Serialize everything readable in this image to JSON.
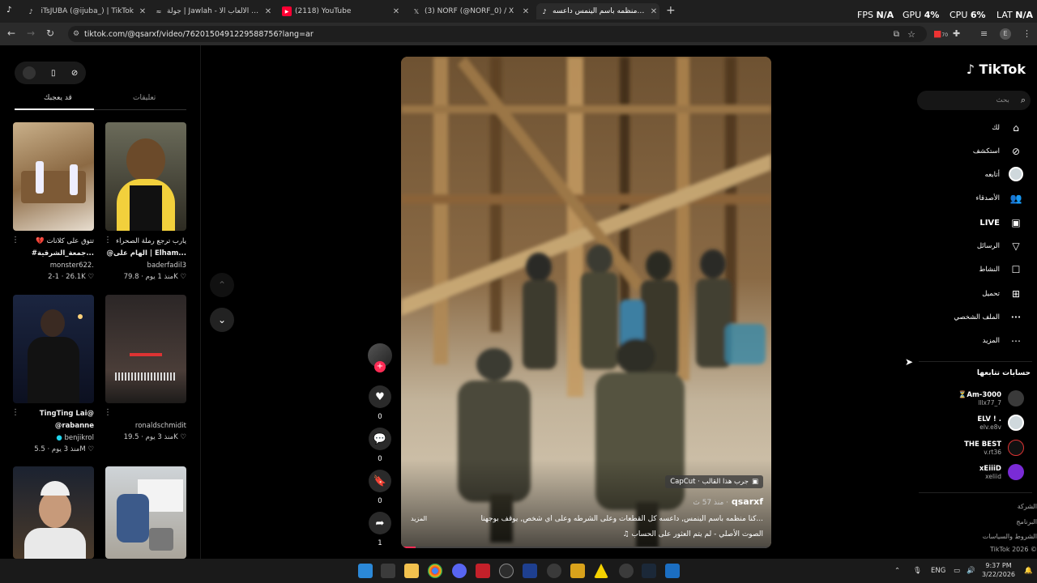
{
  "browser": {
    "tabs": [
      {
        "title": "iTsJUBA (@ijuba_) | TikTok",
        "favicon": "tiktok-icon"
      },
      {
        "title": "جولة | Jawlah - منصة الألعاب الا...",
        "favicon": "jawlah-icon"
      },
      {
        "title": "(2118) YouTube",
        "favicon": "youtube-icon"
      },
      {
        "title": "(3) NORF (@NORF_0) / X",
        "favicon": "x-icon"
      },
      {
        "title": "كنا منظمه باسم الينمس داعسه",
        "favicon": "tiktok-icon",
        "active": true
      }
    ],
    "new_tab": "+",
    "url": "tiktok.com/@qsarxf/video/7620150491229588756?lang=ar",
    "perf": {
      "fps_label": "FPS",
      "fps_value": "N/A",
      "gpu_label": "GPU",
      "gpu_value": "4%",
      "cpu_label": "CPU",
      "cpu_value": "6%",
      "lat_label": "LAT",
      "lat_value": "N/A"
    },
    "ext_badge": "70"
  },
  "left_panel": {
    "tabs": [
      "قد يعجبك",
      "تعليقات"
    ],
    "active_tab": "قد يعجبك",
    "videos": [
      {
        "caption": "💔 تتوق على كلانات",
        "caption2": "#جمعة_الشرقية...",
        "user": "monster622.",
        "likes": "26.1K",
        "date": "2-1"
      },
      {
        "caption": "يارب ترجع رملة الصحراء",
        "caption2": "@الهام على | Elham...",
        "user": "baderfadil3",
        "likes": "79.8K",
        "date": "منذ 1 يوم"
      },
      {
        "caption": "TingTing Lai@",
        "caption2": "@rabanne",
        "user": "benjikrol",
        "likes": "5.5M",
        "date": "منذ 3 يوم"
      },
      {
        "caption": "",
        "caption2": "",
        "user": "ronaldschmidit",
        "likes": "19.5K",
        "date": "منذ 3 يوم"
      },
      {
        "caption": "",
        "caption2": "",
        "user": "",
        "likes": "",
        "date": ""
      },
      {
        "caption": "",
        "caption2": "",
        "user": "",
        "likes": "",
        "date": ""
      }
    ]
  },
  "video": {
    "capcut": "CapCut · جرب هذا القالب",
    "username": "qsarxf",
    "time": "منذ 57 ث ·",
    "description": "كنا منظمه باسم الينمس, داعسه كل القطعات وعلى الشرطه وعلى اي شخص, يوقف بوجهنا...",
    "more": "المزيد",
    "sound": "♫ الصوت الأصلي - لم يتم العثور على الحساب",
    "progress": 0.04,
    "actions": {
      "likes": "0",
      "comments": "0",
      "saves": "0",
      "shares": "1"
    }
  },
  "sidebar": {
    "logo": "TikTok",
    "search_placeholder": "بحث",
    "nav": [
      {
        "label": "لك",
        "icon": "home-icon"
      },
      {
        "label": "استكشف",
        "icon": "compass-icon"
      },
      {
        "label": "أتابعه",
        "icon": "following-icon"
      },
      {
        "label": "الأصدقاء",
        "icon": "friends-icon"
      },
      {
        "label": "LIVE",
        "icon": "live-icon"
      },
      {
        "label": "الرسائل",
        "icon": "send-icon"
      },
      {
        "label": "النشاط",
        "icon": "activity-icon"
      },
      {
        "label": "تحميل",
        "icon": "upload-icon"
      },
      {
        "label": "الملف الشخصي",
        "icon": "profile-icon"
      },
      {
        "label": "المزيد",
        "icon": "more-icon"
      }
    ],
    "following_title": "حسابات تتابعها",
    "following": [
      {
        "name": "⏳Am-3000",
        "handle": "lllx77_7"
      },
      {
        "name": "ELV ! .",
        "handle": "elv.e8v"
      },
      {
        "name": "THE BEST",
        "handle": "v.rt36"
      },
      {
        "name": "xEiiiD",
        "handle": "xeliid"
      }
    ],
    "footer": [
      "الشركة",
      "البرنامج",
      "الشروط والسياسات",
      "TikTok 2026 ©"
    ]
  },
  "taskbar": {
    "lang": "ENG",
    "time": "9:37 PM",
    "date": "3/22/2026"
  },
  "colors": {
    "accent": "#fe2c55",
    "bg": "#000000",
    "chrome": "#1f1f1f"
  }
}
